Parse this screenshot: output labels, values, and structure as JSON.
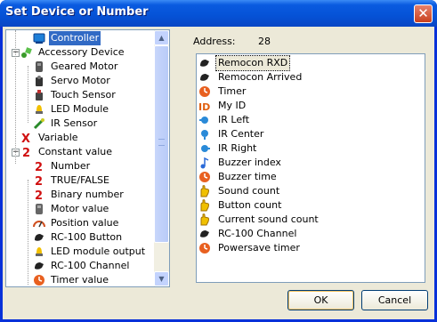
{
  "window": {
    "title": "Set Device or Number",
    "close_glyph": "✕"
  },
  "tree": {
    "items": [
      {
        "label": "Controller",
        "icon": "controller-icon",
        "level": 1,
        "selected": true
      },
      {
        "label": "Accessory Device",
        "icon": "accessory-device-icon",
        "level": 0,
        "expander": "−"
      },
      {
        "label": "Geared Motor",
        "icon": "geared-motor-icon",
        "level": 1
      },
      {
        "label": "Servo Motor",
        "icon": "servo-motor-icon",
        "level": 1
      },
      {
        "label": "Touch Sensor",
        "icon": "touch-sensor-icon",
        "level": 1
      },
      {
        "label": "LED Module",
        "icon": "led-module-icon",
        "level": 1
      },
      {
        "label": "IR Sensor",
        "icon": "ir-sensor-icon",
        "level": 1
      },
      {
        "label": "Variable",
        "icon": "variable-icon",
        "level": 0
      },
      {
        "label": "Constant value",
        "icon": "constant-value-icon",
        "level": 0,
        "expander": "−"
      },
      {
        "label": "Number",
        "icon": "number-icon",
        "level": 1
      },
      {
        "label": "TRUE/FALSE",
        "icon": "true-false-icon",
        "level": 1
      },
      {
        "label": "Binary number",
        "icon": "binary-number-icon",
        "level": 1
      },
      {
        "label": "Motor value",
        "icon": "motor-value-icon",
        "level": 1
      },
      {
        "label": "Position value",
        "icon": "position-value-icon",
        "level": 1
      },
      {
        "label": "RC-100 Button",
        "icon": "rc100-button-icon",
        "level": 1
      },
      {
        "label": "LED module output",
        "icon": "led-module-output-icon",
        "level": 1
      },
      {
        "label": "RC-100 Channel",
        "icon": "rc100-channel-icon",
        "level": 1
      },
      {
        "label": "Timer value",
        "icon": "timer-value-icon",
        "level": 1
      }
    ]
  },
  "address": {
    "label": "Address:",
    "value": "28"
  },
  "list": {
    "items": [
      {
        "label": "Remocon RXD",
        "icon": "remocon-icon",
        "selected": true
      },
      {
        "label": "Remocon Arrived",
        "icon": "remocon-icon"
      },
      {
        "label": "Timer",
        "icon": "timer-icon"
      },
      {
        "label": "My ID",
        "icon": "id-icon"
      },
      {
        "label": "IR Left",
        "icon": "ir-left-icon"
      },
      {
        "label": "IR Center",
        "icon": "ir-center-icon"
      },
      {
        "label": "IR Right",
        "icon": "ir-right-icon"
      },
      {
        "label": "Buzzer index",
        "icon": "buzzer-note-icon"
      },
      {
        "label": "Buzzer time",
        "icon": "timer-icon"
      },
      {
        "label": "Sound count",
        "icon": "hand-icon"
      },
      {
        "label": "Button count",
        "icon": "hand-icon"
      },
      {
        "label": "Current sound count",
        "icon": "hand-icon"
      },
      {
        "label": "RC-100 Channel",
        "icon": "remocon-icon"
      },
      {
        "label": "Powersave timer",
        "icon": "timer-icon"
      }
    ]
  },
  "buttons": {
    "ok": "OK",
    "cancel": "Cancel"
  },
  "colors": {
    "titlebar": "#0552d6",
    "selection": "#316ac5",
    "dialog_bg": "#ece9d8"
  }
}
